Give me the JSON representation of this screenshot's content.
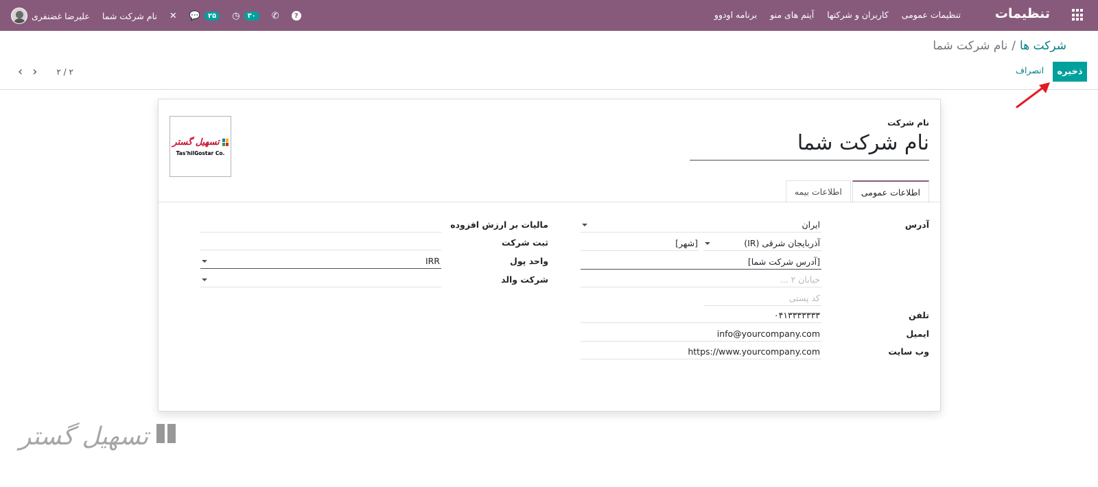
{
  "topbar": {
    "app_title": "تنظیمات",
    "menu": [
      "تنظیمات عمومی",
      "کاربران و شرکتها",
      "آیتم های منو",
      "برنامه اودوو"
    ],
    "user_name": "علیرضا غضنفری",
    "company_switch": "نام شرکت شما",
    "messages_count": "۲۵",
    "activities_count": "۳۰",
    "bg_color": "#875a7b",
    "icons": [
      "apps-icon",
      "help-icon",
      "phone-icon",
      "clock-icon",
      "chat-icon",
      "tools-icon"
    ]
  },
  "control_panel": {
    "breadcrumb_parent": "شرکت ها",
    "breadcrumb_sep": "/",
    "breadcrumb_current": "نام شرکت شما",
    "save_label": "ذخیره",
    "cancel_label": "انصراف",
    "pager_value": "۲ / ۲",
    "accent_color": "#00a09d"
  },
  "form": {
    "logo": {
      "text_fa": "تسهیل گستر",
      "text_en": "Tas'hilGostar Co."
    },
    "name_label": "نام شرکت",
    "name_value": "نام شرکت شما",
    "tabs": [
      "اطلاعات عمومی",
      "اطلاعات بیمه"
    ],
    "active_tab": "اطلاعات عمومی",
    "address_label": "آدرس",
    "country": "ایران",
    "state": "آذربایجان شرقی (IR)",
    "city": "[شهر]",
    "street": "[آدرس شرکت شما]",
    "street2_placeholder": "خیابان ۲ ...",
    "zip_placeholder": "کد پستی",
    "phone_label": "تلفن",
    "phone": "۰۴۱۳۳۳۳۳۳۳",
    "email_label": "ایمیل",
    "email": "info@yourcompany.com",
    "website_label": "وب سایت",
    "website": "https://www.yourcompany.com",
    "vat_label": "مالیات بر ارزش افزوده",
    "vat": "",
    "registry_label": "ثبت شرکت",
    "registry": "",
    "currency_label": "واحد پول",
    "currency": "IRR",
    "parent_label": "شرکت والد",
    "parent": ""
  },
  "watermark": {
    "text": "تسهیل گستر"
  }
}
